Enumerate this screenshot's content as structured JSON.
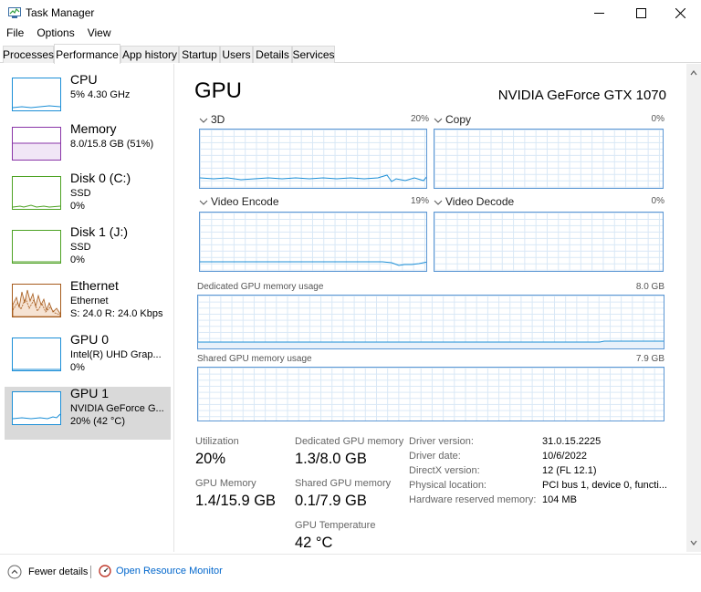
{
  "window": {
    "title": "Task Manager"
  },
  "menu": [
    "File",
    "Options",
    "View"
  ],
  "tabs": [
    "Processes",
    "Performance",
    "App history",
    "Startup",
    "Users",
    "Details",
    "Services"
  ],
  "sidebar": {
    "items": [
      {
        "name": "CPU",
        "line1": "5%  4.30 GHz",
        "line2": "",
        "line3": "",
        "color": "#1c8fd7"
      },
      {
        "name": "Memory",
        "line1": "8.0/15.8 GB (51%)",
        "line2": "",
        "line3": "",
        "color": "#8a35a8"
      },
      {
        "name": "Disk 0 (C:)",
        "line1": "SSD",
        "line2": "0%",
        "line3": "",
        "color": "#4da223"
      },
      {
        "name": "Disk 1 (J:)",
        "line1": "SSD",
        "line2": "0%",
        "line3": "",
        "color": "#4da223"
      },
      {
        "name": "Ethernet",
        "line1": "Ethernet",
        "line2": "S: 24.0  R: 24.0 Kbps",
        "line3": "",
        "color": "#a65b1c"
      },
      {
        "name": "GPU 0",
        "line1": "Intel(R) UHD Grap...",
        "line2": "0%",
        "line3": "",
        "color": "#1c8fd7"
      },
      {
        "name": "GPU 1",
        "line1": "NVIDIA GeForce G...",
        "line2": "20% (42 °C)",
        "line3": "",
        "color": "#1c8fd7"
      }
    ]
  },
  "main": {
    "title": "GPU",
    "model": "NVIDIA GeForce GTX 1070",
    "graphs": {
      "g3d": {
        "label": "3D",
        "pct": "20%"
      },
      "copy": {
        "label": "Copy",
        "pct": "0%"
      },
      "encode": {
        "label": "Video Encode",
        "pct": "19%"
      },
      "decode": {
        "label": "Video Decode",
        "pct": "0%"
      }
    },
    "dedicated": {
      "label": "Dedicated GPU memory usage",
      "max": "8.0 GB"
    },
    "shared": {
      "label": "Shared GPU memory usage",
      "max": "7.9 GB"
    },
    "stats": {
      "utilization": {
        "label": "Utilization",
        "value": "20%"
      },
      "dedicated_mem": {
        "label": "Dedicated GPU memory",
        "value": "1.3/8.0 GB"
      },
      "gpu_memory": {
        "label": "GPU Memory",
        "value": "1.4/15.9 GB"
      },
      "shared_mem": {
        "label": "Shared GPU memory",
        "value": "0.1/7.9 GB"
      },
      "temperature": {
        "label": "GPU Temperature",
        "value": "42 °C"
      }
    },
    "details": [
      {
        "label": "Driver version:",
        "value": "31.0.15.2225"
      },
      {
        "label": "Driver date:",
        "value": "10/6/2022"
      },
      {
        "label": "DirectX version:",
        "value": "12 (FL 12.1)"
      },
      {
        "label": "Physical location:",
        "value": "PCI bus 1, device 0, functi..."
      },
      {
        "label": "Hardware reserved memory:",
        "value": "104 MB"
      }
    ]
  },
  "footer": {
    "fewer_details": "Fewer details",
    "resource_monitor": "Open Resource Monitor"
  },
  "colors": {
    "gpu_line": "#1c8fd7",
    "graph_border": "#5c97d4",
    "grid": "#d9e8f6",
    "link": "#0066cc"
  }
}
